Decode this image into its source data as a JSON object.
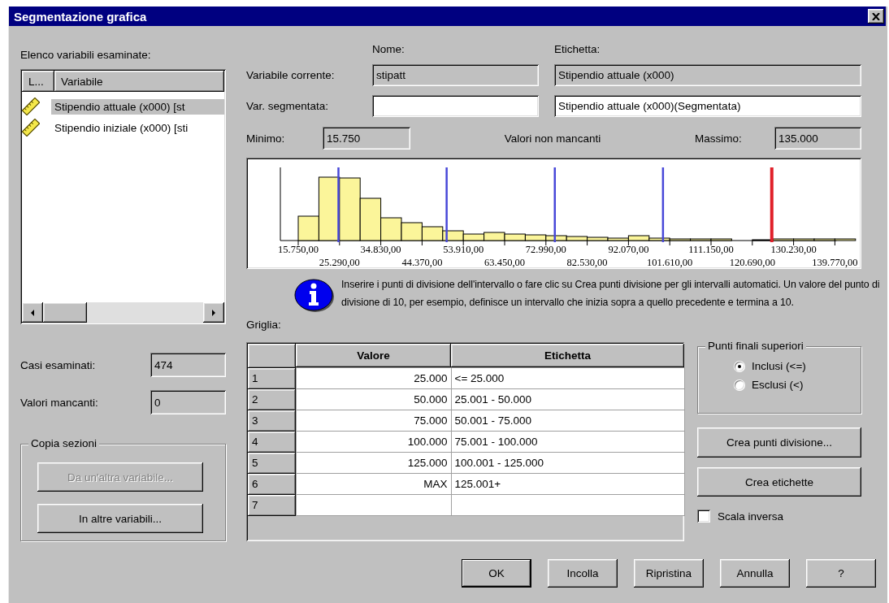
{
  "window": {
    "title": "Segmentazione grafica"
  },
  "variable_list": {
    "label": "Elenco variabili esaminate:",
    "columns": [
      "L...",
      "Variabile"
    ],
    "items": [
      {
        "text": "Stipendio attuale (x000) [st",
        "selected": true
      },
      {
        "text": "Stipendio iniziale (x000) [sti",
        "selected": false
      }
    ]
  },
  "stats": [
    {
      "label": "Casi esaminati:",
      "value": "474"
    },
    {
      "label": "Valori mancanti:",
      "value": "0"
    }
  ],
  "copy_group": {
    "title": "Copia sezioni",
    "buttons": [
      {
        "label": "Da un'altra variabile...",
        "disabled": true
      },
      {
        "label": "In altre variabili...",
        "disabled": false
      }
    ]
  },
  "variable": {
    "name_heading": "Nome:",
    "label_heading": "Etichetta:",
    "rows": [
      {
        "label": "Variabile corrente:",
        "name": {
          "value": "stipatt",
          "readonly": true
        },
        "etichetta": {
          "value": "Stipendio attuale (x000)",
          "readonly": true
        }
      },
      {
        "label": "Var. segmentata:",
        "name": {
          "readonly": false
        },
        "etichetta": {
          "value": "Stipendio attuale (x000)(Segmentata)",
          "readonly": false
        }
      }
    ]
  },
  "range": {
    "min_label": "Minimo:",
    "min": "15.750",
    "caption": "Valori non mancanti",
    "max_label": "Massimo:",
    "max": "135.000"
  },
  "histogram": {
    "tick_labels": [
      "15.750,00",
      "25.290,00",
      "34.830,00",
      "44.370,00",
      "53.910,00",
      "63.450,00",
      "72.990,00",
      "82.530,00",
      "92.070,00",
      "101.610,00",
      "111.150,00",
      "120.690,00",
      "130.230,00",
      "139.770,00"
    ]
  },
  "info": "Inserire i punti di divisione dell'intervallo o fare clic su Crea punti divisione per gli intervalli automatici. Un valore del punto di divisione di 10, per esempio, definisce un intervallo che inizia sopra a quello precedente e termina a 10.",
  "grid": {
    "label": "Griglia:",
    "columns": [
      "Valore",
      "Etichetta"
    ],
    "rows": [
      {
        "index": "1",
        "value": "25.000",
        "label": "<= 25.000"
      },
      {
        "index": "2",
        "value": "50.000",
        "label": "25.001 - 50.000"
      },
      {
        "index": "3",
        "value": "75.000",
        "label": "50.001 - 75.000"
      },
      {
        "index": "4",
        "value": "100.000",
        "label": "75.001 - 100.000"
      },
      {
        "index": "5",
        "value": "125.000",
        "label": "100.001 - 125.000"
      },
      {
        "index": "6",
        "value": "MAX",
        "label": "125.001+"
      },
      {
        "index": "7"
      }
    ]
  },
  "endpoints": {
    "title": "Punti finali superiori",
    "options": [
      {
        "label": "Inclusi (<=)",
        "selected": true
      },
      {
        "label": "Esclusi (<)",
        "selected": false
      }
    ]
  },
  "actions": [
    "Crea punti divisione...",
    "Crea etichette"
  ],
  "reverse_scale": {
    "label": "Scala inversa",
    "checked": false
  },
  "buttons": [
    {
      "label": "OK",
      "default": true
    },
    {
      "label": "Incolla",
      "default": false
    },
    {
      "label": "Ripristina",
      "default": false
    },
    {
      "label": "Annulla",
      "default": false
    },
    {
      "label": "?",
      "default": false
    }
  ]
}
